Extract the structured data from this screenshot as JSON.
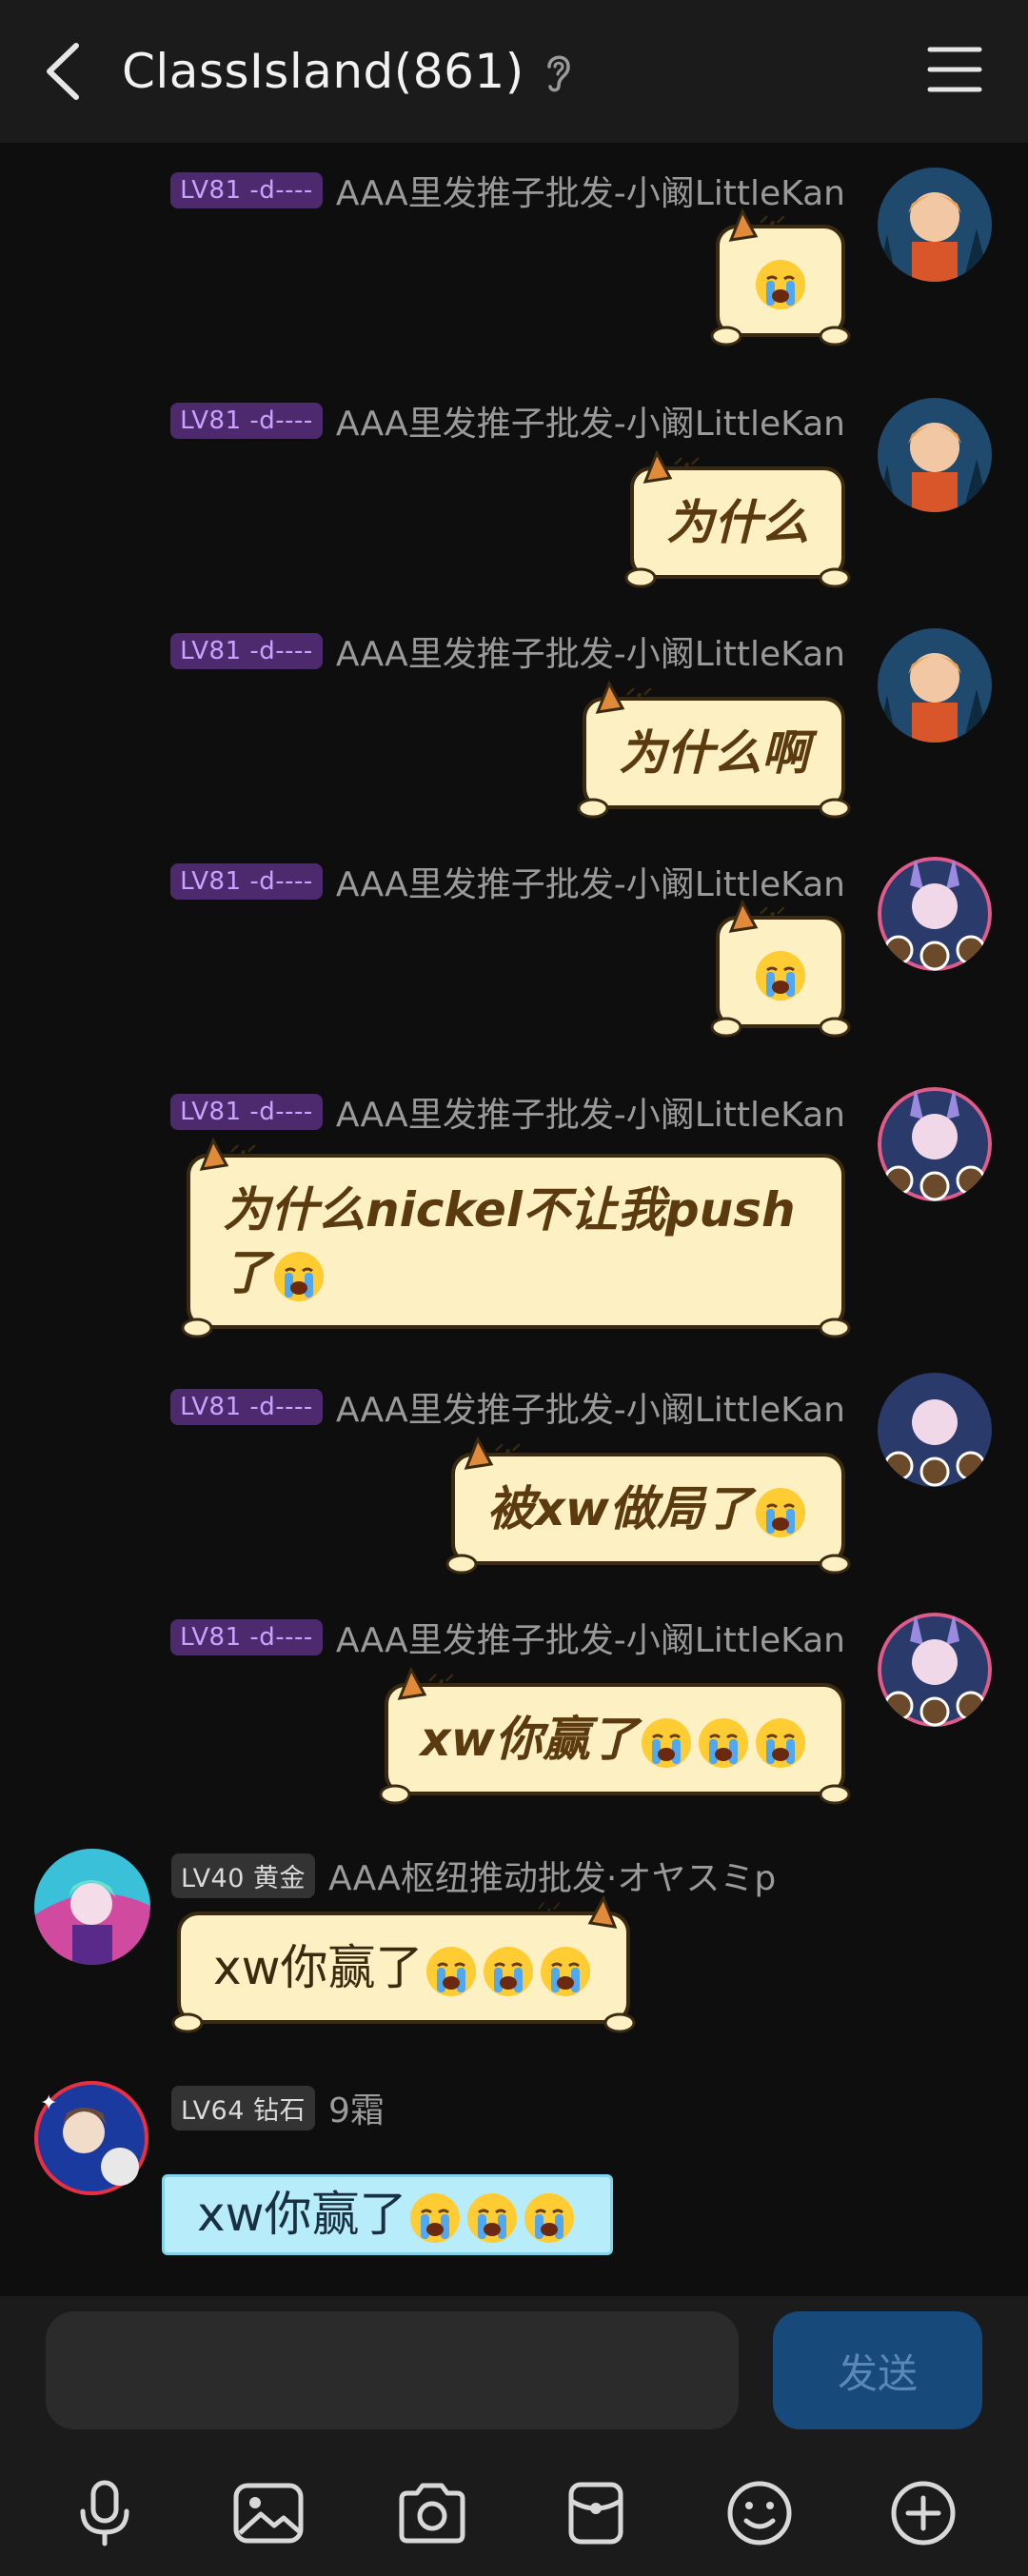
{
  "header": {
    "title": "ClassIsland(861)"
  },
  "messages": [
    {
      "side": "right",
      "level": "LV81 -d----",
      "nick": "AAA里发推子批发-小阚LittleKan",
      "text": "",
      "emojis": 1
    },
    {
      "side": "right",
      "level": "LV81 -d----",
      "nick": "AAA里发推子批发-小阚LittleKan",
      "text": "为什么",
      "emojis": 0
    },
    {
      "side": "right",
      "level": "LV81 -d----",
      "nick": "AAA里发推子批发-小阚LittleKan",
      "text": "为什么啊",
      "emojis": 0
    },
    {
      "side": "right",
      "level": "LV81 -d----",
      "nick": "AAA里发推子批发-小阚LittleKan",
      "text": "",
      "emojis": 1
    },
    {
      "side": "right",
      "level": "LV81 -d----",
      "nick": "AAA里发推子批发-小阚LittleKan",
      "text_line1": "为什么nickel不让我push",
      "text_line2": "了",
      "emojis": 1
    },
    {
      "side": "right",
      "level": "LV81 -d----",
      "nick": "AAA里发推子批发-小阚LittleKan",
      "text": "被xw做局了",
      "emojis": 1
    },
    {
      "side": "right",
      "level": "LV81 -d----",
      "nick": "AAA里发推子批发-小阚LittleKan",
      "text": "xw你赢了",
      "emojis": 3
    },
    {
      "side": "left",
      "level": "LV40 黄金",
      "nick": "AAA枢纽推动批发·オヤスミp",
      "text": "xw你赢了",
      "emojis": 3
    },
    {
      "side": "left",
      "level": "LV64 钻石",
      "nick": "9霜",
      "text": "xw你赢了",
      "emojis": 3
    }
  ],
  "input": {
    "placeholder": "",
    "value": ""
  },
  "send_button": "发送",
  "toolbar": [
    "microphone-icon",
    "image-icon",
    "camera-icon",
    "red-packet-icon",
    "emoji-icon",
    "plus-icon"
  ],
  "colors": {
    "background": "#0e0e0f",
    "bar": "#1b1b1c",
    "bubble_cream": "#fdf0c2",
    "bubble_cyan": "#b7ecfb",
    "send_button": "#17497b",
    "level_badge": "#4d2a6e"
  }
}
